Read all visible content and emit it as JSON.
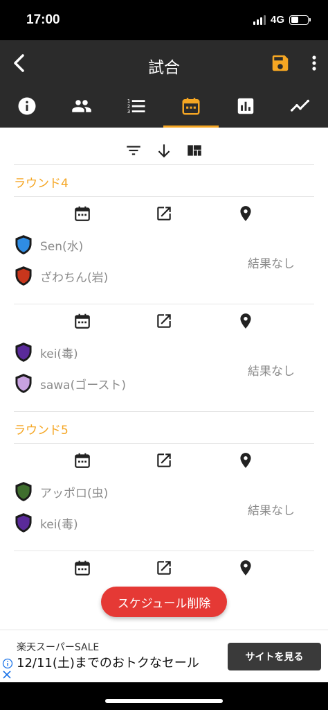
{
  "status_bar": {
    "time": "17:00",
    "network": "4G",
    "battery_level": 0.45
  },
  "app_bar": {
    "title": "試合",
    "accent_color": "#f5a623",
    "background": "#2b2b2b"
  },
  "tabs": [
    {
      "icon": "info-icon",
      "active": false
    },
    {
      "icon": "people-icon",
      "active": false
    },
    {
      "icon": "ranked-list-icon",
      "active": false
    },
    {
      "icon": "calendar-icon",
      "active": true
    },
    {
      "icon": "bar-chart-icon",
      "active": false
    },
    {
      "icon": "trend-line-icon",
      "active": false
    }
  ],
  "toolbar": {
    "icons": [
      "filter-icon",
      "sort-down-icon",
      "layout-icon"
    ]
  },
  "rounds": [
    {
      "label": "ラウンド4",
      "matches": [
        {
          "team1": {
            "name": "Sen(水)",
            "color": "#2f8de4"
          },
          "team2": {
            "name": "ざわちん(岩)",
            "color": "#c8361c"
          },
          "result": "結果なし"
        },
        {
          "team1": {
            "name": "kei(毒)",
            "color": "#5a2a9a"
          },
          "team2": {
            "name": "sawa(ゴースト)",
            "color": "#c8a2e0"
          },
          "result": "結果なし"
        }
      ]
    },
    {
      "label": "ラウンド5",
      "matches": [
        {
          "team1": {
            "name": "アッポロ(虫)",
            "color": "#3f6e2e"
          },
          "team2": {
            "name": "kei(毒)",
            "color": "#5a2a9a"
          },
          "result": "結果なし"
        }
      ]
    }
  ],
  "fab": {
    "label": "スケジュール削除",
    "color": "#e53935"
  },
  "ad": {
    "line1": "楽天スーパーSALE",
    "line2": "12/11(土)までのおトクなセール",
    "cta": "サイトを見る"
  }
}
